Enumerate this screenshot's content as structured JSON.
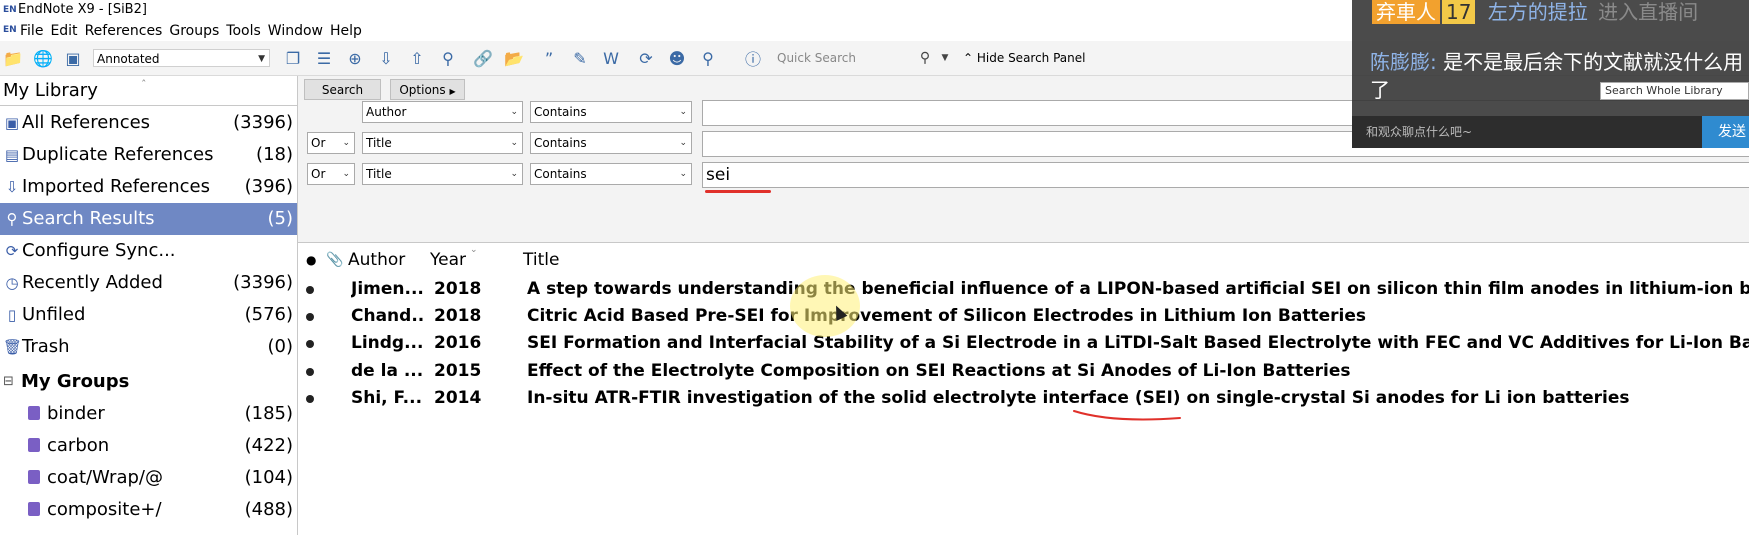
{
  "window": {
    "title": "EndNote X9 - [SiB2]",
    "app_icon_text": "EN"
  },
  "menubar": {
    "items": [
      "File",
      "Edit",
      "References",
      "Groups",
      "Tools",
      "Window",
      "Help"
    ]
  },
  "toolbar": {
    "style": "Annotated",
    "quick_search_placeholder": "Quick Search",
    "hide_search_panel": "Hide Search Panel"
  },
  "sidebar": {
    "header": "My Library",
    "library": [
      {
        "label": "All References",
        "count": "(3396)",
        "icon": "all-references-icon"
      },
      {
        "label": "Duplicate References",
        "count": "(18)",
        "icon": "duplicate-icon"
      },
      {
        "label": "Imported References",
        "count": "(396)",
        "icon": "import-icon"
      },
      {
        "label": "Search Results",
        "count": "(5)",
        "icon": "search-results-icon"
      },
      {
        "label": "Configure Sync...",
        "count": "",
        "icon": "sync-icon"
      },
      {
        "label": "Recently Added",
        "count": "(3396)",
        "icon": "clock-icon"
      },
      {
        "label": "Unfiled",
        "count": "(576)",
        "icon": "unfiled-icon"
      },
      {
        "label": "Trash",
        "count": "(0)",
        "icon": "trash-icon"
      }
    ],
    "groups_header": "My Groups",
    "groups": [
      {
        "label": "binder",
        "count": "(185)"
      },
      {
        "label": "carbon",
        "count": "(422)"
      },
      {
        "label": "coat/Wrap/@",
        "count": "(104)"
      },
      {
        "label": "composite+/",
        "count": "(488)"
      }
    ]
  },
  "search_panel": {
    "search_button": "Search",
    "options_button": "Options",
    "rows": [
      {
        "bool": "",
        "field": "Author",
        "op": "Contains",
        "value": ""
      },
      {
        "bool": "Or",
        "field": "Title",
        "op": "Contains",
        "value": ""
      },
      {
        "bool": "Or",
        "field": "Title",
        "op": "Contains",
        "value": "sei"
      }
    ]
  },
  "results": {
    "columns": {
      "author": "Author",
      "year": "Year",
      "title": "Title"
    },
    "rows": [
      {
        "author": "Jimen...",
        "year": "2018",
        "title": "A step towards understanding the beneficial influence of a LIPON-based artificial SEI on silicon thin film anodes in lithium-ion batteries"
      },
      {
        "author": "Chand...",
        "year": "2018",
        "title": "Citric Acid Based Pre-SEI for Improvement of Silicon Electrodes in Lithium Ion Batteries"
      },
      {
        "author": "Lindg...",
        "year": "2016",
        "title": "SEI Formation and Interfacial Stability of a Si Electrode in a LiTDI-Salt Based Electrolyte with FEC and VC Additives for Li-Ion Batteries"
      },
      {
        "author": "de la ...",
        "year": "2015",
        "title": "Effect of the Electrolyte Composition on SEI Reactions at Si Anodes of Li-Ion Batteries"
      },
      {
        "author": "Shi, F...",
        "year": "2014",
        "title": "In-situ ATR-FTIR investigation of the solid electrolyte interface (SEI) on single-crystal Si anodes for Li ion batteries"
      }
    ]
  },
  "overlay": {
    "badge": "弃車人",
    "level": "17",
    "live_text": "左方的提拉",
    "enter_live": "进入直播间",
    "message_user": "陈膨膨:",
    "message_text": "是不是最后余下的文献就没什么用了",
    "scope_select": "Search Whole Library",
    "chat_placeholder": "和观众聊点什么吧~",
    "send_label": "发送"
  }
}
